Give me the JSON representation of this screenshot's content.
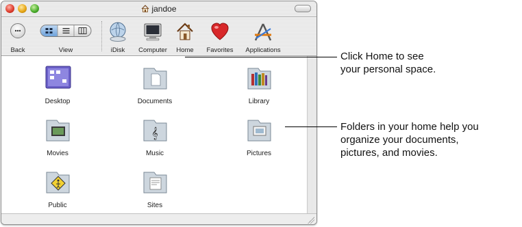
{
  "window": {
    "title": "jandoe"
  },
  "toolbar": {
    "back_label": "Back",
    "view_label": "View",
    "items": [
      {
        "label": "iDisk",
        "icon": "idisk-icon"
      },
      {
        "label": "Computer",
        "icon": "computer-icon"
      },
      {
        "label": "Home",
        "icon": "home-icon"
      },
      {
        "label": "Favorites",
        "icon": "favorites-icon"
      },
      {
        "label": "Applications",
        "icon": "applications-icon"
      }
    ]
  },
  "folders": [
    {
      "label": "Desktop",
      "icon": "desktop-folder-icon"
    },
    {
      "label": "Documents",
      "icon": "documents-folder-icon"
    },
    {
      "label": "Library",
      "icon": "library-folder-icon"
    },
    {
      "label": "Movies",
      "icon": "movies-folder-icon"
    },
    {
      "label": "Music",
      "icon": "music-folder-icon"
    },
    {
      "label": "Pictures",
      "icon": "pictures-folder-icon"
    },
    {
      "label": "Public",
      "icon": "public-folder-icon"
    },
    {
      "label": "Sites",
      "icon": "sites-folder-icon"
    }
  ],
  "callouts": {
    "home": {
      "line1": "Click Home to see",
      "line2": "your personal space."
    },
    "folders": {
      "line1": "Folders in your home help you",
      "line2": "organize your documents,",
      "line3": "pictures, and movies."
    }
  },
  "colors": {
    "accent": "#6fa3dc",
    "folder": "#c9d3dc"
  }
}
